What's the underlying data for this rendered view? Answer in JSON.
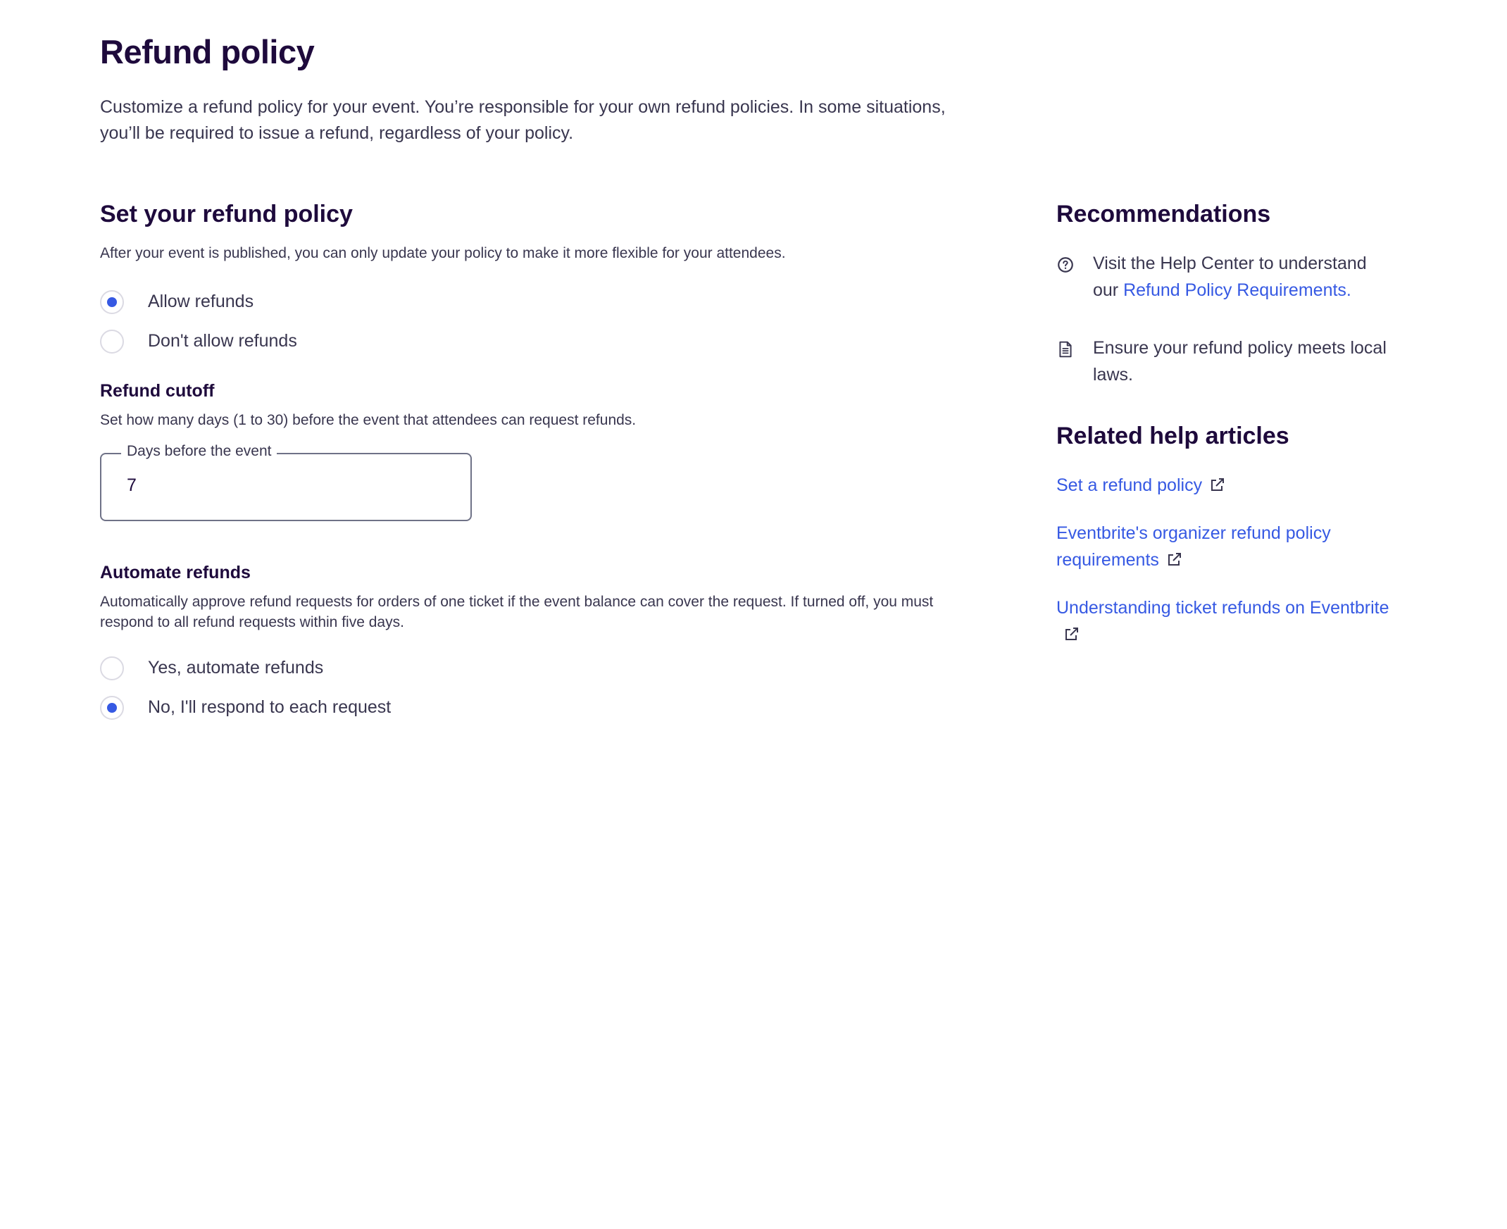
{
  "page": {
    "title": "Refund policy",
    "intro": "Customize a refund policy for your event. You’re responsible for your own refund policies. In some situations, you’ll be required to issue a refund, regardless of your policy."
  },
  "refund_policy": {
    "heading": "Set your refund policy",
    "description": "After your event is published, you can only update your policy to make it more flexible for your attendees.",
    "options": [
      {
        "label": "Allow refunds",
        "selected": true
      },
      {
        "label": "Don't allow refunds",
        "selected": false
      }
    ]
  },
  "refund_cutoff": {
    "heading": "Refund cutoff",
    "description": "Set how many days (1 to 30) before the event that attendees can request refunds.",
    "field_label": "Days before the event",
    "field_value": "7"
  },
  "automate_refunds": {
    "heading": "Automate refunds",
    "description": "Automatically approve refund requests for orders of one ticket if the event balance can cover the request. If turned off, you must respond to all refund requests within five days.",
    "options": [
      {
        "label": "Yes, automate refunds",
        "selected": false
      },
      {
        "label": "No, I'll respond to each request",
        "selected": true
      }
    ]
  },
  "recommendations": {
    "heading": "Recommendations",
    "items": [
      {
        "icon": "help-circle-icon",
        "text": "Visit the Help Center to understand our ",
        "link": "Refund Policy Requirements."
      },
      {
        "icon": "document-icon",
        "text": "Ensure your refund policy meets local laws."
      }
    ]
  },
  "related_help": {
    "heading": "Related help articles",
    "links": [
      {
        "label": "Set a refund policy",
        "icon": "external-link-icon"
      },
      {
        "label": "Eventbrite's organizer refund policy requirements",
        "icon": "external-link-icon"
      },
      {
        "label": "Understanding ticket refunds on Eventbrite",
        "icon": "external-link-icon"
      }
    ]
  },
  "colors": {
    "link": "#3659e3",
    "heading": "#1e0a3c",
    "text": "#39364f",
    "radio_selected": "#3659e3",
    "radio_border": "#dbdae3"
  }
}
